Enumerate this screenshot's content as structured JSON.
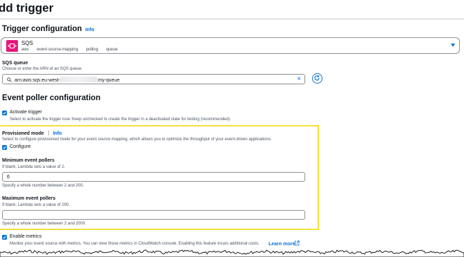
{
  "page": {
    "title": "dd trigger"
  },
  "trigger_config": {
    "heading": "Trigger configuration",
    "info": "Info",
    "selected": {
      "name": "SQS",
      "tags": [
        "aws",
        "event-source-mapping",
        "polling",
        "queue"
      ]
    }
  },
  "sqs_queue": {
    "label": "SQS queue",
    "description": "Choose or enter the ARN of an SQS queue.",
    "value_prefix": "arn:aws:sqs:eu-west-",
    "value_suffix": ":my-queue"
  },
  "event_poller": {
    "heading": "Event poller configuration",
    "activate": {
      "label": "Activate trigger",
      "checked": true,
      "description": "Select to activate the trigger now. Keep unchecked to create the trigger in a deactivated state for testing (recommended)."
    },
    "provisioned": {
      "label": "Provisioned mode",
      "info": "Info",
      "description": "Select to configure provisioned mode for your event source mapping, which allows you to optimize the throughput of your event-driven applications.",
      "configure_label": "Configure",
      "configure_checked": true,
      "min": {
        "label": "Minimum event pollers",
        "hint": "If blank, Lambda sets a value of 2.",
        "value": "6",
        "constraint": "Specify a whole number between 2 and 200."
      },
      "max": {
        "label": "Maximum event pollers",
        "hint": "If blank, Lambda sets a value of 200.",
        "value": "",
        "constraint": "Specify a whole number between 2 and 2000."
      }
    },
    "metrics": {
      "label": "Enable metrics",
      "checked": true,
      "description": "Monitor your event source with metrics. You can view those metrics in CloudWatch console. Enabling this feature incurs additional costs.",
      "learn_more": "Learn more"
    }
  },
  "colors": {
    "accent": "#0972d3",
    "highlight": "#f5e03a",
    "sqs_brand": "#e7157b"
  },
  "icons": [
    "sqs-service-icon",
    "chevron-down-icon",
    "search-icon",
    "clear-icon",
    "refresh-icon",
    "check-icon",
    "external-link-icon"
  ]
}
